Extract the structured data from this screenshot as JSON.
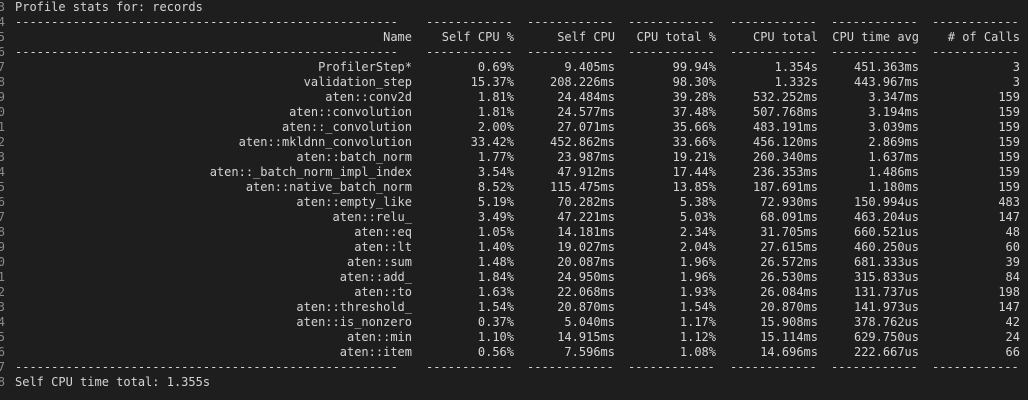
{
  "title": "Profile stats for: records",
  "line_numbers": [
    "3",
    "4",
    "5",
    "6",
    "7",
    "8",
    "9",
    "0",
    "1",
    "2",
    "3",
    "4",
    "5",
    "6",
    "7",
    "8",
    "9",
    "0",
    "1",
    "2",
    "3",
    "4",
    "5",
    "6",
    "7",
    "8"
  ],
  "dash_row": [
    "-----------------------------------------------------",
    "------------",
    "------------",
    "------------",
    "------------",
    "------------",
    "------------"
  ],
  "columns": [
    "Name",
    "Self CPU %",
    "Self CPU",
    "CPU total %",
    "CPU total",
    "CPU time avg",
    "# of Calls"
  ],
  "rows": [
    [
      "ProfilerStep*",
      "0.69%",
      "9.405ms",
      "99.94%",
      "1.354s",
      "451.363ms",
      "3"
    ],
    [
      "validation_step",
      "15.37%",
      "208.226ms",
      "98.30%",
      "1.332s",
      "443.967ms",
      "3"
    ],
    [
      "aten::conv2d",
      "1.81%",
      "24.484ms",
      "39.28%",
      "532.252ms",
      "3.347ms",
      "159"
    ],
    [
      "aten::convolution",
      "1.81%",
      "24.577ms",
      "37.48%",
      "507.768ms",
      "3.194ms",
      "159"
    ],
    [
      "aten::_convolution",
      "2.00%",
      "27.071ms",
      "35.66%",
      "483.191ms",
      "3.039ms",
      "159"
    ],
    [
      "aten::mkldnn_convolution",
      "33.42%",
      "452.862ms",
      "33.66%",
      "456.120ms",
      "2.869ms",
      "159"
    ],
    [
      "aten::batch_norm",
      "1.77%",
      "23.987ms",
      "19.21%",
      "260.340ms",
      "1.637ms",
      "159"
    ],
    [
      "aten::_batch_norm_impl_index",
      "3.54%",
      "47.912ms",
      "17.44%",
      "236.353ms",
      "1.486ms",
      "159"
    ],
    [
      "aten::native_batch_norm",
      "8.52%",
      "115.475ms",
      "13.85%",
      "187.691ms",
      "1.180ms",
      "159"
    ],
    [
      "aten::empty_like",
      "5.19%",
      "70.282ms",
      "5.38%",
      "72.930ms",
      "150.994us",
      "483"
    ],
    [
      "aten::relu_",
      "3.49%",
      "47.221ms",
      "5.03%",
      "68.091ms",
      "463.204us",
      "147"
    ],
    [
      "aten::eq",
      "1.05%",
      "14.181ms",
      "2.34%",
      "31.705ms",
      "660.521us",
      "48"
    ],
    [
      "aten::lt",
      "1.40%",
      "19.027ms",
      "2.04%",
      "27.615ms",
      "460.250us",
      "60"
    ],
    [
      "aten::sum",
      "1.48%",
      "20.087ms",
      "1.96%",
      "26.572ms",
      "681.333us",
      "39"
    ],
    [
      "aten::add_",
      "1.84%",
      "24.950ms",
      "1.96%",
      "26.530ms",
      "315.833us",
      "84"
    ],
    [
      "aten::to",
      "1.63%",
      "22.068ms",
      "1.93%",
      "26.084ms",
      "131.737us",
      "198"
    ],
    [
      "aten::threshold_",
      "1.54%",
      "20.870ms",
      "1.54%",
      "20.870ms",
      "141.973us",
      "147"
    ],
    [
      "aten::is_nonzero",
      "0.37%",
      "5.040ms",
      "1.17%",
      "15.908ms",
      "378.762us",
      "42"
    ],
    [
      "aten::min",
      "1.10%",
      "14.915ms",
      "1.12%",
      "15.114ms",
      "629.750us",
      "24"
    ],
    [
      "aten::item",
      "0.56%",
      "7.596ms",
      "1.08%",
      "14.696ms",
      "222.667us",
      "66"
    ]
  ],
  "footer": "Self CPU time total: 1.355s"
}
